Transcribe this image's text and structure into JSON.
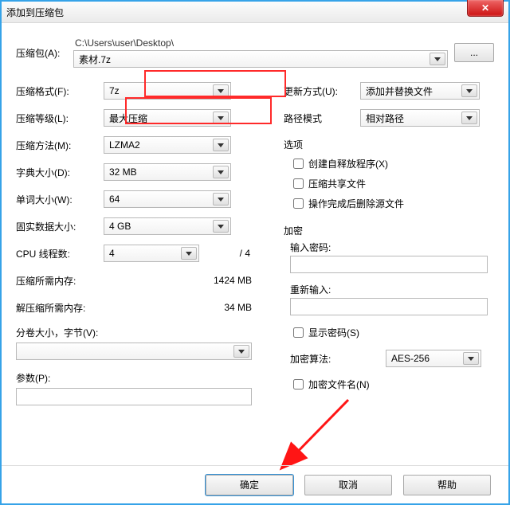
{
  "window": {
    "title": "添加到压缩包"
  },
  "archive": {
    "label": "压缩包(A):",
    "path_prefix": "C:\\Users\\user\\Desktop\\",
    "filename": "素材.7z",
    "browse": "..."
  },
  "left": {
    "format": {
      "label": "压缩格式(F):",
      "value": "7z"
    },
    "level": {
      "label": "压缩等级(L):",
      "value": "最大压缩"
    },
    "method": {
      "label": "压缩方法(M):",
      "value": "LZMA2"
    },
    "dict": {
      "label": "字典大小(D):",
      "value": "32 MB"
    },
    "word": {
      "label": "单词大小(W):",
      "value": "64"
    },
    "solid": {
      "label": "固实数据大小:",
      "value": "4 GB"
    },
    "threads": {
      "label": "CPU 线程数:",
      "value": "4",
      "max": "/ 4"
    },
    "mem_comp": {
      "label": "压缩所需内存:",
      "value": "1424 MB"
    },
    "mem_decomp": {
      "label": "解压缩所需内存:",
      "value": "34 MB"
    },
    "split": {
      "label": "分卷大小，字节(V):"
    },
    "params": {
      "label": "参数(P):"
    }
  },
  "right": {
    "update": {
      "label": "更新方式(U):",
      "value": "添加并替换文件"
    },
    "pathmode": {
      "label": "路径模式",
      "value": "相对路径"
    },
    "options_title": "选项",
    "opt_sfx": "创建自释放程序(X)",
    "opt_share": "压缩共享文件",
    "opt_delete": "操作完成后删除源文件",
    "enc_title": "加密",
    "pw_label": "输入密码:",
    "pw2_label": "重新输入:",
    "show_pw": "显示密码(S)",
    "algo_label": "加密算法:",
    "algo_value": "AES-256",
    "enc_names": "加密文件名(N)"
  },
  "footer": {
    "ok": "确定",
    "cancel": "取消",
    "help": "帮助"
  }
}
